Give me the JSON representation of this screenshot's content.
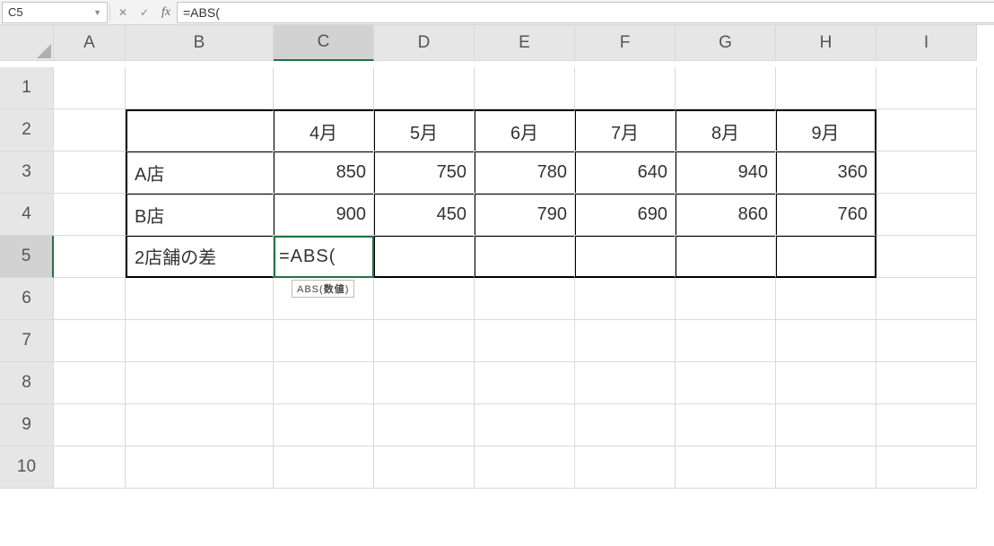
{
  "name_box": {
    "value": "C5"
  },
  "formula_bar": {
    "input": "=ABS("
  },
  "columns": [
    "A",
    "B",
    "C",
    "D",
    "E",
    "F",
    "G",
    "H",
    "I"
  ],
  "rows": [
    "1",
    "2",
    "3",
    "4",
    "5",
    "6",
    "7",
    "8",
    "9",
    "10"
  ],
  "active": {
    "col": "C",
    "row": "5"
  },
  "table": {
    "headers": [
      "4月",
      "5月",
      "6月",
      "7月",
      "8月",
      "9月"
    ],
    "rowsLabels": [
      "A店",
      "B店",
      "2店舗の差"
    ],
    "r1": [
      "850",
      "750",
      "780",
      "640",
      "940",
      "360"
    ],
    "r2": [
      "900",
      "450",
      "790",
      "690",
      "860",
      "760"
    ]
  },
  "editing_cell_text": "=ABS(",
  "tooltip": {
    "fn": "ABS",
    "arg": "数値"
  },
  "icons": {
    "dropdown": "▼",
    "cancel": "✕",
    "enter": "✓",
    "fx": "fx"
  }
}
